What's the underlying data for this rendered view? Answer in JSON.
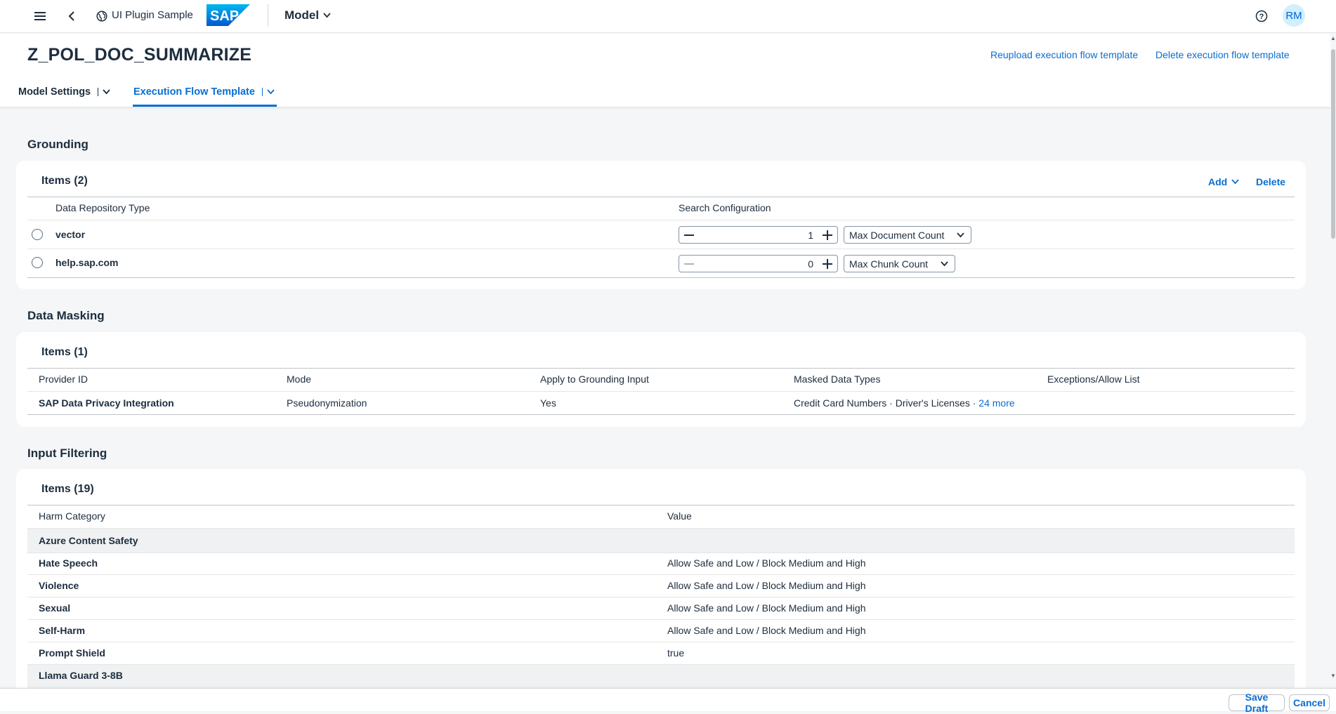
{
  "shell": {
    "app_title": "UI Plugin Sample",
    "logo_text": "SAP",
    "menu_title": "Model",
    "avatar_initials": "RM"
  },
  "header": {
    "object_title": "Z_POL_DOC_SUMMARIZE",
    "actions": [
      "Reupload execution flow template",
      "Delete execution flow template"
    ],
    "tabs": [
      {
        "label": "Model Settings",
        "active": false
      },
      {
        "label": "Execution Flow Template",
        "active": true
      }
    ]
  },
  "grounding": {
    "section_title": "Grounding",
    "items_title": "Items (2)",
    "add_label": "Add",
    "delete_label": "Delete",
    "columns": [
      "Data Repository Type",
      "Search Configuration"
    ],
    "rows": [
      {
        "type": "vector",
        "count": "1",
        "option": "Max Document Count"
      },
      {
        "type": "help.sap.com",
        "count": "0",
        "option": "Max Chunk Count"
      }
    ]
  },
  "data_masking": {
    "section_title": "Data Masking",
    "items_title": "Items (1)",
    "columns": [
      "Provider ID",
      "Mode",
      "Apply to Grounding Input",
      "Masked Data Types",
      "Exceptions/Allow List"
    ],
    "rows": [
      {
        "provider": "SAP Data Privacy Integration",
        "mode": "Pseudonymization",
        "apply": "Yes",
        "types": "Credit Card Numbers · Driver's Licenses · ",
        "more": "24 more",
        "exceptions": ""
      }
    ]
  },
  "input_filtering": {
    "section_title": "Input Filtering",
    "items_title": "Items (19)",
    "columns": [
      "Harm Category",
      "Value"
    ],
    "rows": [
      {
        "group": true,
        "label": "Azure Content Safety",
        "value": ""
      },
      {
        "group": false,
        "label": "Hate Speech",
        "value": "Allow Safe and Low / Block Medium and High"
      },
      {
        "group": false,
        "label": "Violence",
        "value": "Allow Safe and Low / Block Medium and High"
      },
      {
        "group": false,
        "label": "Sexual",
        "value": "Allow Safe and Low / Block Medium and High"
      },
      {
        "group": false,
        "label": "Self-Harm",
        "value": "Allow Safe and Low / Block Medium and High"
      },
      {
        "group": false,
        "label": "Prompt Shield",
        "value": "true"
      },
      {
        "group": true,
        "label": "Llama Guard 3-8B",
        "value": ""
      }
    ]
  },
  "footer": {
    "save_draft": "Save Draft",
    "cancel": "Cancel"
  },
  "colors": {
    "accent": "#0a6ed1",
    "brand_blue": "#0070f2",
    "background": "#f5f6f7"
  }
}
